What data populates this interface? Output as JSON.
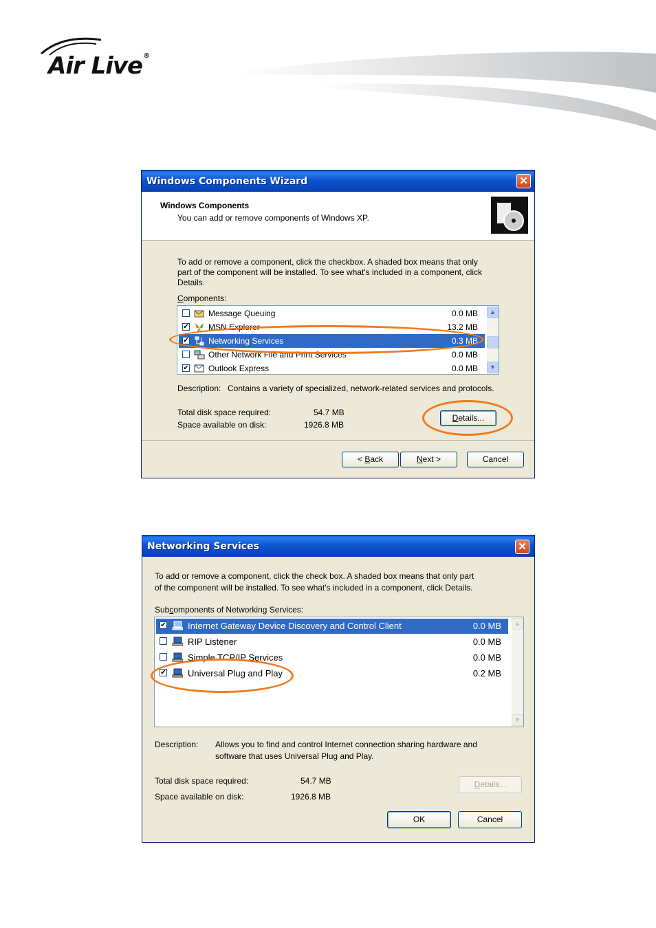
{
  "logo": {
    "brand": "Air Live",
    "mark": "®"
  },
  "wizard": {
    "title": "Windows Components Wizard",
    "heading": "Windows Components",
    "subheading": "You can add or remove components of Windows XP.",
    "instructions_line1": "To add or remove a component, click the checkbox.  A shaded box means that only",
    "instructions_line2": "part of the component will be installed.  To see what's included in a component, click",
    "instructions_line3": "Details.",
    "components_label": "Components:",
    "components_label_accesskey": "C",
    "components_label_rest": "omponents:",
    "components": [
      {
        "label": "Message Queuing",
        "size": "0.0 MB",
        "checked": false,
        "icon": "message-queuing-icon"
      },
      {
        "label": "MSN Explorer",
        "size": "13.2 MB",
        "checked": true,
        "icon": "msn-butterfly-icon"
      },
      {
        "label": "Networking Services",
        "size": "0.3 MB",
        "checked": true,
        "selected": true,
        "icon": "networking-icon"
      },
      {
        "label": "Other Network File and Print Services",
        "size": "0.0 MB",
        "checked": false,
        "icon": "network-print-icon"
      },
      {
        "label": "Outlook Express",
        "size": "0.0 MB",
        "checked": true,
        "icon": "outlook-express-icon"
      }
    ],
    "description_label": "Description:",
    "description": "Contains a variety of specialized, network-related services and protocols.",
    "total_label": "Total disk space required:",
    "total_value": "54.7 MB",
    "available_label": "Space available on disk:",
    "available_value": "1926.8 MB",
    "details_button": "Details...",
    "details_accesskey": "D",
    "details_rest": "etails...",
    "back_button": "< Back",
    "back_prefix": "< ",
    "back_accesskey": "B",
    "back_rest": "ack",
    "next_button": "Next >",
    "next_accesskey": "N",
    "next_rest": "ext >",
    "cancel_button": "Cancel"
  },
  "netdialog": {
    "title": "Networking Services",
    "instructions_line1": "To add or remove a component, click the check box. A shaded box means that only part",
    "instructions_line2": "of the component will be installed. To see what's included in a component, click Details.",
    "subcomponents_label": "Subcomponents of Networking Services:",
    "subcomponents_label_pre": "Sub",
    "subcomponents_label_accesskey": "c",
    "subcomponents_label_rest": "omponents of Networking Services:",
    "items": [
      {
        "label": "Internet Gateway Device Discovery and Control Client",
        "size": "0.0 MB",
        "checked": true,
        "selected": true,
        "icon": "network-computer-icon"
      },
      {
        "label": "RIP Listener",
        "size": "0.0 MB",
        "checked": false,
        "icon": "network-computer-icon"
      },
      {
        "label": "Simple TCP/IP Services",
        "size": "0.0 MB",
        "checked": false,
        "icon": "network-computer-icon"
      },
      {
        "label": "Universal Plug and Play",
        "size": "0.2 MB",
        "checked": true,
        "icon": "network-computer-icon"
      }
    ],
    "description_label": "Description:",
    "description_line1": "Allows you to find and control Internet connection sharing hardware and",
    "description_line2": "software that uses Universal Plug and Play.",
    "total_label": "Total disk space required:",
    "total_value": "54.7 MB",
    "available_label": "Space available on disk:",
    "available_value": "1926.8 MB",
    "details_button": "Details...",
    "details_accesskey": "D",
    "details_rest": "etails...",
    "ok_button": "OK",
    "cancel_button": "Cancel"
  },
  "colors": {
    "highlight_oval": "#f07a1e",
    "selection": "#316ac5",
    "titlebar": "#0a5fd8"
  }
}
